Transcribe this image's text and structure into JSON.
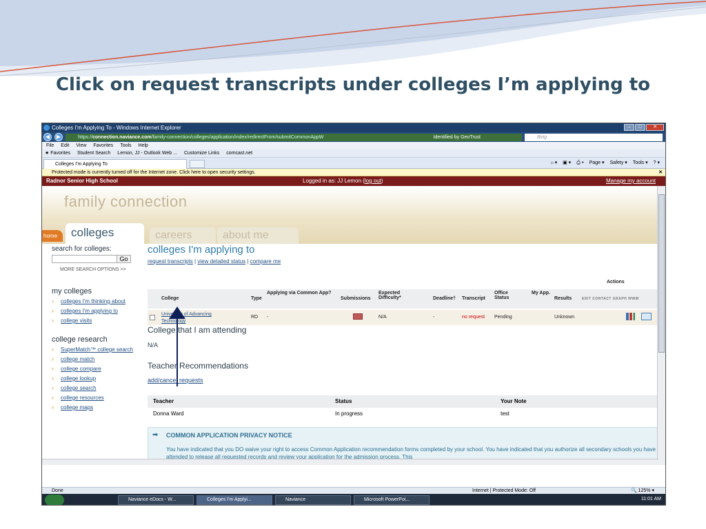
{
  "slide": {
    "title": "Click on request transcripts under colleges I’m applying to"
  },
  "browser": {
    "window_title": "Colleges I'm Applying To - Windows Internet Explorer",
    "url_prefix": "https://",
    "url_domain": "connection.naviance.com",
    "url_rest": "/family-connection/colleges/application/index/redirectFrom/submitCommonAppW",
    "identified_by": "Identified by GeoTrust",
    "search_placeholder": "Bing",
    "menu": [
      "File",
      "Edit",
      "View",
      "Favorites",
      "Tools",
      "Help"
    ],
    "favorites": [
      "Favorites",
      "Student Search",
      "Lemon, JJ - Outlook Web ...",
      "Customize Links",
      "comcast.net"
    ],
    "tab_title": "Colleges I'm Applying To",
    "commands": [
      "Page ▾",
      "Safety ▾",
      "Tools ▾"
    ],
    "protected_mode_msg": "Protected mode is currently turned off for the Internet zone.  Click here to open security settings.",
    "status_left": "Done",
    "status_zone": "Internet | Protected Mode: Off",
    "zoom": "125%"
  },
  "site": {
    "school": "Radnor Senior High School",
    "logged_in": "Logged in as: JJ Lemon (",
    "logout": "log out",
    "logged_in_close": ")",
    "manage": "Manage my account",
    "brand": "family connection",
    "tabs": {
      "home": "home",
      "colleges": "colleges",
      "careers": "careers",
      "about": "about me"
    }
  },
  "sidebar": {
    "search_heading": "search for colleges:",
    "go": "Go",
    "more": "MORE SEARCH OPTIONS >>",
    "my_colleges": "my colleges",
    "my_links": [
      "colleges I'm thinking about",
      "colleges I'm applying to",
      "college visits"
    ],
    "research": "college research",
    "research_links": [
      "SuperMatch™ college search",
      "college match",
      "college compare",
      "college lookup",
      "college search",
      "college resources",
      "college maps"
    ]
  },
  "main": {
    "heading": "colleges I'm applying to",
    "links": [
      "request transcripts",
      "view detailed status",
      "compare me"
    ],
    "actions": "Actions",
    "columns": {
      "college": "College",
      "type": "Type",
      "via_common": "Applying via Common App?",
      "submissions": "Submissions",
      "difficulty": "Expected Difficulty*",
      "deadline": "Deadline†",
      "transcript": "Transcript",
      "office": "Office Status",
      "myapp": "My App.",
      "results": "Results",
      "action_labels": "EDIT CONTACT GRAPH WWW"
    },
    "row": {
      "college": "University of Advancing Technology",
      "type": "RD",
      "via_common": "-",
      "difficulty": "N/A",
      "deadline": "-",
      "transcript": "no request",
      "office": "Pending",
      "results": "Unknown"
    },
    "attending_heading": "College that I am attending",
    "attending_value": "N/A",
    "teacher_heading": "Teacher Recommendations",
    "add_cancel": "add/cancel requests",
    "teacher_cols": {
      "teacher": "Teacher",
      "status": "Status",
      "note": "Your Note"
    },
    "teacher_row": {
      "teacher": "Donna Ward",
      "status": "In progress",
      "note": "test"
    },
    "notice_heading": "COMMON APPLICATION PRIVACY NOTICE",
    "notice_text": "You have indicated that you DO waive your right to access Common Application recommendation forms completed by your school. You have indicated that you authorize all secondary schools you have attended to release all requested records and review your application for the admission process. This"
  },
  "taskbar": {
    "items": [
      "Naviance eDocs - W...",
      "Colleges I'm Applyi...",
      "Naviance",
      "Microsoft PowerPoi..."
    ],
    "clock": "11:01 AM"
  },
  "colors": {
    "accent_blue": "#2e7ba8",
    "school_bar": "#7a1a1a",
    "arrow": "#0c1f58",
    "no_request": "#cc0000"
  }
}
